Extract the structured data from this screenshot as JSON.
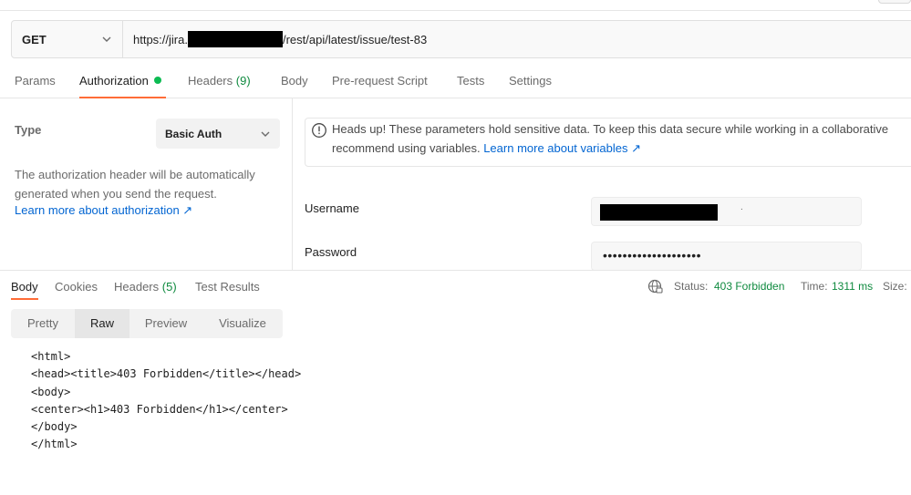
{
  "request": {
    "method": "GET",
    "url_prefix": "https://jira.",
    "url_suffix": "/rest/api/latest/issue/test-83"
  },
  "request_tabs": [
    {
      "label": "Params"
    },
    {
      "label": "Authorization"
    },
    {
      "label": "Headers",
      "count": "(9)"
    },
    {
      "label": "Body"
    },
    {
      "label": "Pre-request Script"
    },
    {
      "label": "Tests"
    },
    {
      "label": "Settings"
    }
  ],
  "auth": {
    "type_label": "Type",
    "type_value": "Basic Auth",
    "description": "The authorization header will be automatically generated when you send the request.",
    "learn_link": "Learn more about authorization ↗",
    "notice_line1": "Heads up! These parameters hold sensitive data. To keep this data secure while working in a collaborative",
    "notice_line2": "recommend using variables.",
    "notice_link": "Learn more about variables ↗",
    "username_label": "Username",
    "password_label": "Password",
    "password_mask": "••••••••••••••••••••"
  },
  "response_tabs": [
    {
      "label": "Body"
    },
    {
      "label": "Cookies"
    },
    {
      "label": "Headers",
      "count": "(5)"
    },
    {
      "label": "Test Results"
    }
  ],
  "response_status": {
    "status_label": "Status:",
    "status_value": "403 Forbidden",
    "time_label": "Time:",
    "time_value": "1311 ms",
    "size_label": "Size:"
  },
  "view_tabs": [
    "Pretty",
    "Raw",
    "Preview",
    "Visualize"
  ],
  "response_body": [
    "<html>",
    "<head><title>403 Forbidden</title></head>",
    "<body>",
    "<center><h1>403 Forbidden</h1></center>",
    "</body>",
    "</html>"
  ],
  "colors": {
    "accent": "#ff6c37",
    "success": "#0f8a3f",
    "link": "#0265d2",
    "active_dot": "#0cbb52"
  }
}
